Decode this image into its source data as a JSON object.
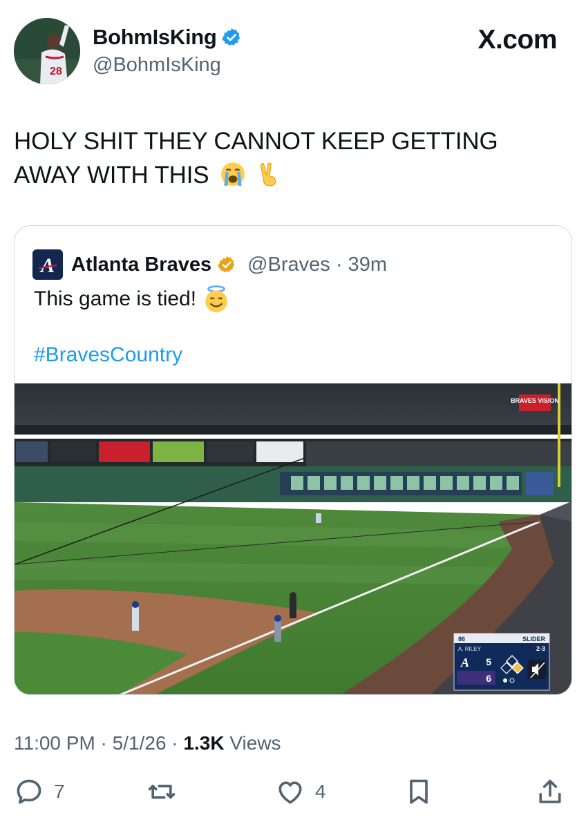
{
  "author": {
    "display_name": "BohmIsKing",
    "handle": "@BohmIsKing",
    "verified": true,
    "avatar_jersey_number": "28"
  },
  "brand": "X.com",
  "tweet": {
    "text": "HOLY SHIT THEY CANNOT KEEP GETTING AWAY WITH THIS",
    "emojis": [
      "loudly-crying-face",
      "victory-hand"
    ]
  },
  "quoted": {
    "display_name": "Atlanta Braves",
    "handle_time": "@Braves · 39m",
    "text": "This game is tied!",
    "text_emoji": "smiling-face-with-halo",
    "hashtag": "#BravesCountry",
    "video": {
      "watermark": "BRAVES VISION",
      "pitch_speed": "86",
      "pitch_type": "SLIDER",
      "count": "2-3",
      "batter": "A. RILEY",
      "atl_score": "5",
      "opp_score": "6"
    }
  },
  "meta": {
    "time": "11:00 PM",
    "sep1": " · ",
    "date": "5/1/26",
    "sep2": " · ",
    "views_count": "1.3K",
    "views_label": " Views"
  },
  "actions": {
    "replies": "7",
    "likes": "4"
  },
  "colors": {
    "verified_blue": "#1d9bf0",
    "gold_check": "#e8a317",
    "link_blue": "#1d9bf0",
    "muted": "#536471",
    "braves_navy": "#13274f"
  }
}
